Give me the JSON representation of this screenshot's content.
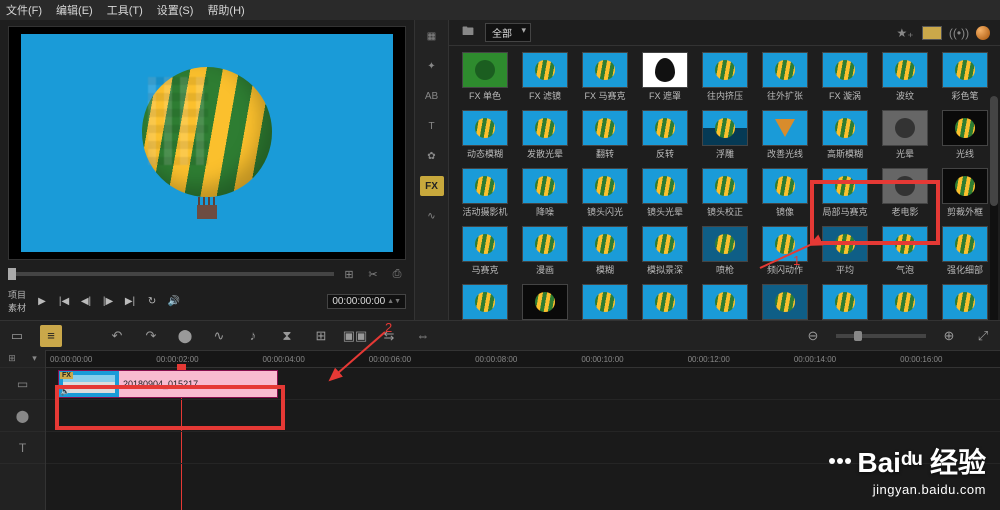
{
  "menu": {
    "file": "文件(F)",
    "edit": "编辑(E)",
    "tool": "工具(T)",
    "setting": "设置(S)",
    "help": "帮助(H)"
  },
  "preview": {
    "tab_project": "项目",
    "tab_clip": "素材",
    "timecode": "00:00:00:00"
  },
  "fx_panel": {
    "category": "全部",
    "side_fx": "FX",
    "side_ab": "AB",
    "side_t": "T",
    "items": [
      {
        "label": "FX 单色",
        "variant": "th-green"
      },
      {
        "label": "FX 滤镜",
        "variant": ""
      },
      {
        "label": "FX 马赛克",
        "variant": ""
      },
      {
        "label": "FX 遮罩",
        "variant": "th-white"
      },
      {
        "label": "往内挤压",
        "variant": ""
      },
      {
        "label": "往外扩张",
        "variant": ""
      },
      {
        "label": "FX 漩涡",
        "variant": ""
      },
      {
        "label": "波纹",
        "variant": ""
      },
      {
        "label": "彩色笔",
        "variant": ""
      },
      {
        "label": "动态模糊",
        "variant": ""
      },
      {
        "label": "发散光晕",
        "variant": ""
      },
      {
        "label": "翻转",
        "variant": ""
      },
      {
        "label": "反转",
        "variant": ""
      },
      {
        "label": "浮雕",
        "variant": "th-half"
      },
      {
        "label": "改善光线",
        "variant": "th-para"
      },
      {
        "label": "高斯模糊",
        "variant": ""
      },
      {
        "label": "光晕",
        "variant": "th-gray"
      },
      {
        "label": "光线",
        "variant": "th-dark"
      },
      {
        "label": "活动摄影机",
        "variant": ""
      },
      {
        "label": "降噪",
        "variant": ""
      },
      {
        "label": "镜头闪光",
        "variant": ""
      },
      {
        "label": "镜头光晕",
        "variant": ""
      },
      {
        "label": "镜头校正",
        "variant": ""
      },
      {
        "label": "镜像",
        "variant": ""
      },
      {
        "label": "局部马赛克",
        "variant": ""
      },
      {
        "label": "老电影",
        "variant": "th-gray"
      },
      {
        "label": "剪裁外框",
        "variant": "th-dark"
      },
      {
        "label": "马赛克",
        "variant": ""
      },
      {
        "label": "漫画",
        "variant": ""
      },
      {
        "label": "模糊",
        "variant": ""
      },
      {
        "label": "模拟景深",
        "variant": ""
      },
      {
        "label": "喷枪",
        "variant": "th-dim"
      },
      {
        "label": "频闪动作",
        "variant": ""
      },
      {
        "label": "平均",
        "variant": "th-dim"
      },
      {
        "label": "气泡",
        "variant": ""
      },
      {
        "label": "强化细部",
        "variant": ""
      },
      {
        "label": "",
        "variant": ""
      },
      {
        "label": "",
        "variant": "th-dark"
      },
      {
        "label": "",
        "variant": ""
      },
      {
        "label": "",
        "variant": ""
      },
      {
        "label": "",
        "variant": ""
      },
      {
        "label": "",
        "variant": "th-dim"
      },
      {
        "label": "",
        "variant": ""
      },
      {
        "label": "",
        "variant": ""
      },
      {
        "label": "",
        "variant": ""
      }
    ]
  },
  "ruler": [
    "00:00:00:00",
    "00:00:02:00",
    "00:00:04:00",
    "00:00:06:00",
    "00:00:08:00",
    "00:00:10:00",
    "00:00:12:00",
    "00:00:14:00",
    "00:00:16:00"
  ],
  "clip": {
    "name": "20180904_015217",
    "fx": "FX"
  },
  "annot": {
    "a1": "1",
    "a2": "2"
  },
  "watermark": {
    "brand": "Baiᵈᵘ 经验",
    "url": "jingyan.baidu.com"
  }
}
